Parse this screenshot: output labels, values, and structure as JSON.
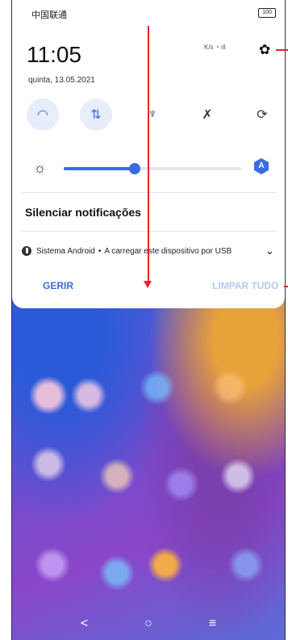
{
  "status_bar": {
    "carrier": "中国联通",
    "battery": "100",
    "net_speed": "K/s"
  },
  "header": {
    "time": "11:05",
    "date": "quinta, 13.05.2021"
  },
  "quick_settings": [
    {
      "name": "wifi",
      "icon": "wifi-icon",
      "active": true
    },
    {
      "name": "mobile-data",
      "icon": "data-arrows-icon",
      "active": true
    },
    {
      "name": "flashlight",
      "icon": "flashlight-icon",
      "active": false
    },
    {
      "name": "bluetooth",
      "icon": "bluetooth-icon",
      "active": false
    },
    {
      "name": "auto-rotate",
      "icon": "rotate-icon",
      "active": false
    }
  ],
  "brightness": {
    "level": 0.4,
    "auto_label": "A"
  },
  "silence": {
    "label": "Silenciar notificações"
  },
  "notification": {
    "app": "Sistema Android",
    "separator": "•",
    "message": "A carregar este dispositivo por USB"
  },
  "actions": {
    "manage": "GERIR",
    "clear_all": "LIMPAR TUDO"
  },
  "colors": {
    "accent": "#3a6be0",
    "annotation": "#e3262b"
  }
}
